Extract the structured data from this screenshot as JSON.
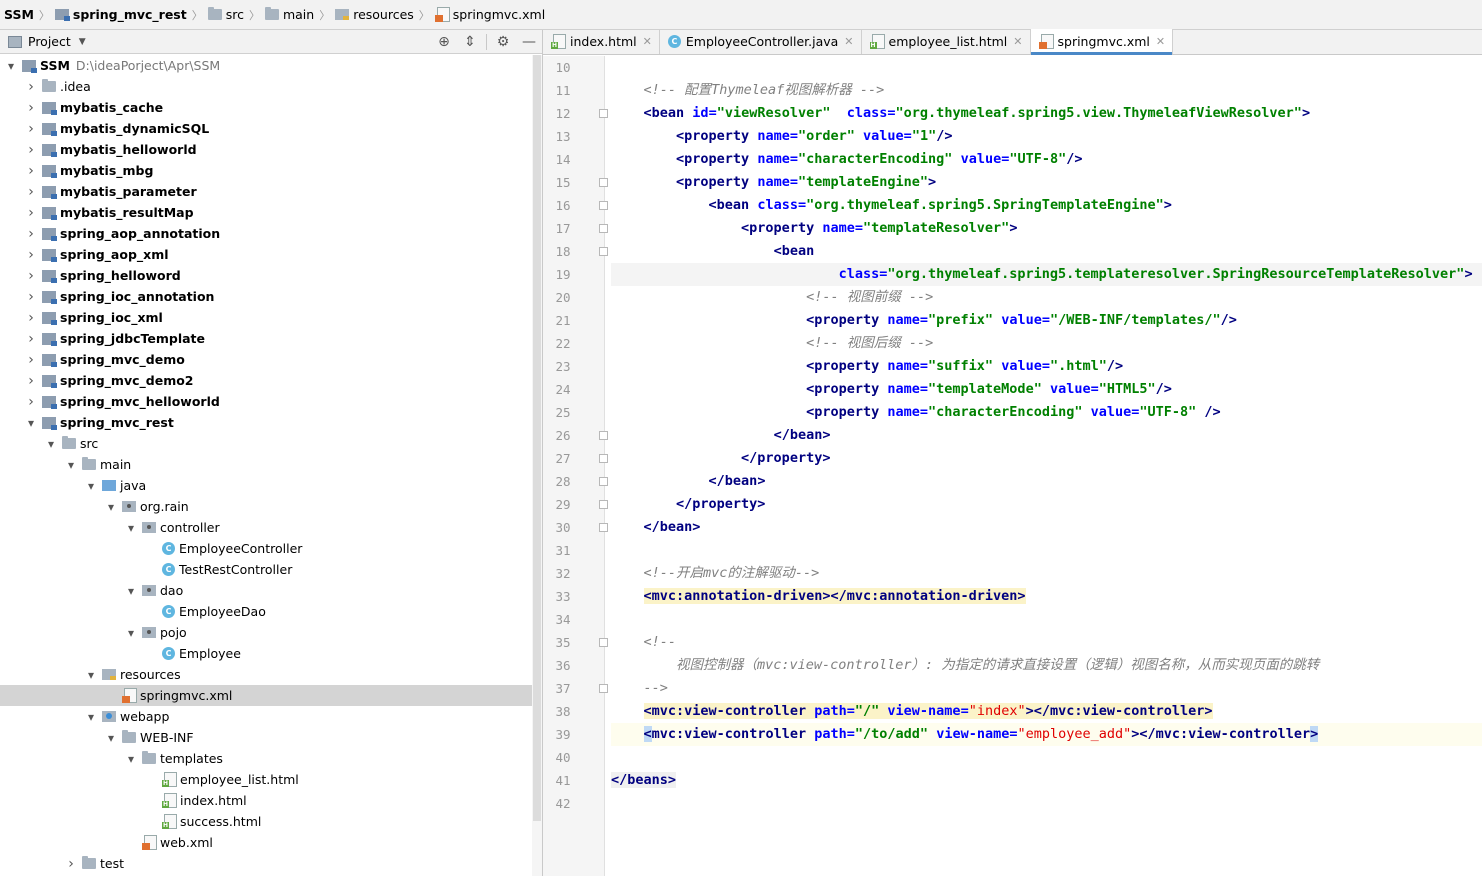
{
  "breadcrumb": [
    "SSM",
    "spring_mvc_rest",
    "src",
    "main",
    "resources",
    "springmvc.xml"
  ],
  "project_panel": {
    "title": "Project",
    "tools": [
      "locate-icon",
      "collapse-icon",
      "gear-icon",
      "minimize-icon"
    ],
    "root_path": "D:\\ideaPorject\\Apr\\SSM",
    "tree": [
      {
        "label": "SSM",
        "depth": 0,
        "kind": "module",
        "expanded": true,
        "bold": true
      },
      {
        "label": ".idea",
        "depth": 1,
        "kind": "folder",
        "expanded": false
      },
      {
        "label": "mybatis_cache",
        "depth": 1,
        "kind": "module",
        "expanded": false,
        "bold": true
      },
      {
        "label": "mybatis_dynamicSQL",
        "depth": 1,
        "kind": "module",
        "expanded": false,
        "bold": true
      },
      {
        "label": "mybatis_helloworld",
        "depth": 1,
        "kind": "module",
        "expanded": false,
        "bold": true
      },
      {
        "label": "mybatis_mbg",
        "depth": 1,
        "kind": "module",
        "expanded": false,
        "bold": true
      },
      {
        "label": "mybatis_parameter",
        "depth": 1,
        "kind": "module",
        "expanded": false,
        "bold": true
      },
      {
        "label": "mybatis_resultMap",
        "depth": 1,
        "kind": "module",
        "expanded": false,
        "bold": true
      },
      {
        "label": "spring_aop_annotation",
        "depth": 1,
        "kind": "module",
        "expanded": false,
        "bold": true
      },
      {
        "label": "spring_aop_xml",
        "depth": 1,
        "kind": "module",
        "expanded": false,
        "bold": true
      },
      {
        "label": "spring_helloword",
        "depth": 1,
        "kind": "module",
        "expanded": false,
        "bold": true
      },
      {
        "label": "spring_ioc_annotation",
        "depth": 1,
        "kind": "module",
        "expanded": false,
        "bold": true
      },
      {
        "label": "spring_ioc_xml",
        "depth": 1,
        "kind": "module",
        "expanded": false,
        "bold": true
      },
      {
        "label": "spring_jdbcTemplate",
        "depth": 1,
        "kind": "module",
        "expanded": false,
        "bold": true
      },
      {
        "label": "spring_mvc_demo",
        "depth": 1,
        "kind": "module",
        "expanded": false,
        "bold": true
      },
      {
        "label": "spring_mvc_demo2",
        "depth": 1,
        "kind": "module",
        "expanded": false,
        "bold": true
      },
      {
        "label": "spring_mvc_helloworld",
        "depth": 1,
        "kind": "module",
        "expanded": false,
        "bold": true
      },
      {
        "label": "spring_mvc_rest",
        "depth": 1,
        "kind": "module",
        "expanded": true,
        "bold": true
      },
      {
        "label": "src",
        "depth": 2,
        "kind": "folder",
        "expanded": true
      },
      {
        "label": "main",
        "depth": 3,
        "kind": "folder",
        "expanded": true
      },
      {
        "label": "java",
        "depth": 4,
        "kind": "src",
        "expanded": true
      },
      {
        "label": "org.rain",
        "depth": 5,
        "kind": "package",
        "expanded": true
      },
      {
        "label": "controller",
        "depth": 6,
        "kind": "package",
        "expanded": true
      },
      {
        "label": "EmployeeController",
        "depth": 7,
        "kind": "class"
      },
      {
        "label": "TestRestController",
        "depth": 7,
        "kind": "class"
      },
      {
        "label": "dao",
        "depth": 6,
        "kind": "package",
        "expanded": true
      },
      {
        "label": "EmployeeDao",
        "depth": 7,
        "kind": "class"
      },
      {
        "label": "pojo",
        "depth": 6,
        "kind": "package",
        "expanded": true
      },
      {
        "label": "Employee",
        "depth": 7,
        "kind": "class"
      },
      {
        "label": "resources",
        "depth": 4,
        "kind": "resources",
        "expanded": true
      },
      {
        "label": "springmvc.xml",
        "depth": 5,
        "kind": "xml",
        "selected": true
      },
      {
        "label": "webapp",
        "depth": 4,
        "kind": "web",
        "expanded": true
      },
      {
        "label": "WEB-INF",
        "depth": 5,
        "kind": "folder",
        "expanded": true
      },
      {
        "label": "templates",
        "depth": 6,
        "kind": "folder",
        "expanded": true
      },
      {
        "label": "employee_list.html",
        "depth": 7,
        "kind": "html"
      },
      {
        "label": "index.html",
        "depth": 7,
        "kind": "html"
      },
      {
        "label": "success.html",
        "depth": 7,
        "kind": "html"
      },
      {
        "label": "web.xml",
        "depth": 6,
        "kind": "xml"
      },
      {
        "label": "test",
        "depth": 3,
        "kind": "folder",
        "expanded": false
      }
    ]
  },
  "tabs": [
    {
      "label": "index.html",
      "icon": "html-file-icon",
      "active": false
    },
    {
      "label": "EmployeeController.java",
      "icon": "java-class-icon",
      "active": false
    },
    {
      "label": "employee_list.html",
      "icon": "html-file-icon",
      "active": false
    },
    {
      "label": "springmvc.xml",
      "icon": "xml-file-icon",
      "active": true
    }
  ],
  "editor": {
    "first_line": 10,
    "highlight_line": 19,
    "caret_line": 39,
    "fold_lines": [
      12,
      15,
      16,
      17,
      18,
      26,
      27,
      28,
      29,
      30,
      35,
      37
    ],
    "bulb_line": 39,
    "lines": [
      [],
      [
        [
          "    ",
          ""
        ],
        [
          "<!-- 配置Thymeleaf视图解析器 -->",
          "cm"
        ]
      ],
      [
        [
          "    ",
          ""
        ],
        [
          "<bean",
          "tg"
        ],
        [
          " ",
          ""
        ],
        [
          "id",
          "an"
        ],
        [
          "=",
          "an"
        ],
        [
          "\"viewResolver\"",
          "av"
        ],
        [
          "  ",
          ""
        ],
        [
          "class",
          "an"
        ],
        [
          "=",
          "an"
        ],
        [
          "\"org.thymeleaf.spring5.view.ThymeleafViewResolver\"",
          "av"
        ],
        [
          ">",
          "tg"
        ]
      ],
      [
        [
          "        ",
          ""
        ],
        [
          "<property",
          "tg"
        ],
        [
          " ",
          ""
        ],
        [
          "name",
          "an"
        ],
        [
          "=",
          "an"
        ],
        [
          "\"order\"",
          "av"
        ],
        [
          " ",
          ""
        ],
        [
          "value",
          "an"
        ],
        [
          "=",
          "an"
        ],
        [
          "\"1\"",
          "av"
        ],
        [
          "/>",
          "tg"
        ]
      ],
      [
        [
          "        ",
          ""
        ],
        [
          "<property",
          "tg"
        ],
        [
          " ",
          ""
        ],
        [
          "name",
          "an"
        ],
        [
          "=",
          "an"
        ],
        [
          "\"characterEncoding\"",
          "av"
        ],
        [
          " ",
          ""
        ],
        [
          "value",
          "an"
        ],
        [
          "=",
          "an"
        ],
        [
          "\"UTF-8\"",
          "av"
        ],
        [
          "/>",
          "tg"
        ]
      ],
      [
        [
          "        ",
          ""
        ],
        [
          "<property",
          "tg"
        ],
        [
          " ",
          ""
        ],
        [
          "name",
          "an"
        ],
        [
          "=",
          "an"
        ],
        [
          "\"templateEngine\"",
          "av"
        ],
        [
          ">",
          "tg"
        ]
      ],
      [
        [
          "            ",
          ""
        ],
        [
          "<bean",
          "tg"
        ],
        [
          " ",
          ""
        ],
        [
          "class",
          "an"
        ],
        [
          "=",
          "an"
        ],
        [
          "\"org.thymeleaf.spring5.SpringTemplateEngine\"",
          "av"
        ],
        [
          ">",
          "tg"
        ]
      ],
      [
        [
          "                ",
          ""
        ],
        [
          "<property",
          "tg"
        ],
        [
          " ",
          ""
        ],
        [
          "name",
          "an"
        ],
        [
          "=",
          "an"
        ],
        [
          "\"templateResolver\"",
          "av"
        ],
        [
          ">",
          "tg"
        ]
      ],
      [
        [
          "                    ",
          ""
        ],
        [
          "<bean",
          "tg"
        ]
      ],
      [
        [
          "                            ",
          ""
        ],
        [
          "class",
          "an"
        ],
        [
          "=",
          "an"
        ],
        [
          "\"org.thymeleaf.spring5.templateresolver.SpringResourceTemplateResolver\"",
          "av"
        ],
        [
          ">",
          "tg"
        ]
      ],
      [
        [
          "                        ",
          ""
        ],
        [
          "<!-- 视图前缀 -->",
          "cm"
        ]
      ],
      [
        [
          "                        ",
          ""
        ],
        [
          "<property",
          "tg"
        ],
        [
          " ",
          ""
        ],
        [
          "name",
          "an"
        ],
        [
          "=",
          "an"
        ],
        [
          "\"prefix\"",
          "av"
        ],
        [
          " ",
          ""
        ],
        [
          "value",
          "an"
        ],
        [
          "=",
          "an"
        ],
        [
          "\"/WEB-INF/templates/\"",
          "av"
        ],
        [
          "/>",
          "tg"
        ]
      ],
      [
        [
          "                        ",
          ""
        ],
        [
          "<!-- 视图后缀 -->",
          "cm"
        ]
      ],
      [
        [
          "                        ",
          ""
        ],
        [
          "<property",
          "tg"
        ],
        [
          " ",
          ""
        ],
        [
          "name",
          "an"
        ],
        [
          "=",
          "an"
        ],
        [
          "\"suffix\"",
          "av"
        ],
        [
          " ",
          ""
        ],
        [
          "value",
          "an"
        ],
        [
          "=",
          "an"
        ],
        [
          "\".html\"",
          "av"
        ],
        [
          "/>",
          "tg"
        ]
      ],
      [
        [
          "                        ",
          ""
        ],
        [
          "<property",
          "tg"
        ],
        [
          " ",
          ""
        ],
        [
          "name",
          "an"
        ],
        [
          "=",
          "an"
        ],
        [
          "\"templateMode\"",
          "av"
        ],
        [
          " ",
          ""
        ],
        [
          "value",
          "an"
        ],
        [
          "=",
          "an"
        ],
        [
          "\"HTML5\"",
          "av"
        ],
        [
          "/>",
          "tg"
        ]
      ],
      [
        [
          "                        ",
          ""
        ],
        [
          "<property",
          "tg"
        ],
        [
          " ",
          ""
        ],
        [
          "name",
          "an"
        ],
        [
          "=",
          "an"
        ],
        [
          "\"characterEncoding\"",
          "av"
        ],
        [
          " ",
          ""
        ],
        [
          "value",
          "an"
        ],
        [
          "=",
          "an"
        ],
        [
          "\"UTF-8\"",
          "av"
        ],
        [
          " />",
          "tg"
        ]
      ],
      [
        [
          "                    ",
          ""
        ],
        [
          "</bean>",
          "tg"
        ]
      ],
      [
        [
          "                ",
          ""
        ],
        [
          "</property>",
          "tg"
        ]
      ],
      [
        [
          "            ",
          ""
        ],
        [
          "</bean>",
          "tg"
        ]
      ],
      [
        [
          "        ",
          ""
        ],
        [
          "</property>",
          "tg"
        ]
      ],
      [
        [
          "    ",
          ""
        ],
        [
          "</bean>",
          "tg"
        ]
      ],
      [],
      [
        [
          "    ",
          ""
        ],
        [
          "<!--开启mvc的注解驱动-->",
          "cm"
        ]
      ],
      [
        [
          "    ",
          ""
        ],
        [
          "<mvc:annotation-driven></mvc:annotation-driven>",
          "tg mvcbg"
        ]
      ],
      [],
      [
        [
          "    ",
          ""
        ],
        [
          "<!--",
          "cm"
        ]
      ],
      [
        [
          "        ",
          ""
        ],
        [
          "视图控制器（mvc:view-controller）: 为指定的请求直接设置（逻辑）视图名称，从而实现页面的跳转",
          "cm"
        ]
      ],
      [
        [
          "    ",
          ""
        ],
        [
          "-->",
          "cm"
        ]
      ],
      [
        [
          "    ",
          ""
        ],
        [
          "<mvc:view-controller",
          "tg mvcbg"
        ],
        [
          " ",
          "mvcbg"
        ],
        [
          "path",
          "an mvcbg"
        ],
        [
          "=",
          "an mvcbg"
        ],
        [
          "\"/\"",
          "av mvcbg"
        ],
        [
          " ",
          "mvcbg"
        ],
        [
          "view-name",
          "an mvcbg"
        ],
        [
          "=",
          "an mvcbg"
        ],
        [
          "\"index\"",
          "red mvcbg"
        ],
        [
          "></mvc:view-controller>",
          "tg mvcbg"
        ]
      ],
      [
        [
          "    ",
          ""
        ],
        [
          "<",
          "tg caretbox"
        ],
        [
          "mvc:view-controller",
          "tg"
        ],
        [
          " ",
          ""
        ],
        [
          "path",
          "an"
        ],
        [
          "=",
          "an"
        ],
        [
          "\"/to/add\"",
          "av"
        ],
        [
          " ",
          ""
        ],
        [
          "view-name",
          "an"
        ],
        [
          "=",
          "an"
        ],
        [
          "\"employee_add\"",
          "red"
        ],
        [
          "></mvc:view-controller",
          "tg"
        ],
        [
          ">",
          "tg caretbox"
        ]
      ],
      [],
      [
        [
          "",
          ""
        ],
        [
          "</beans>",
          "tg tagbg"
        ]
      ],
      []
    ]
  }
}
